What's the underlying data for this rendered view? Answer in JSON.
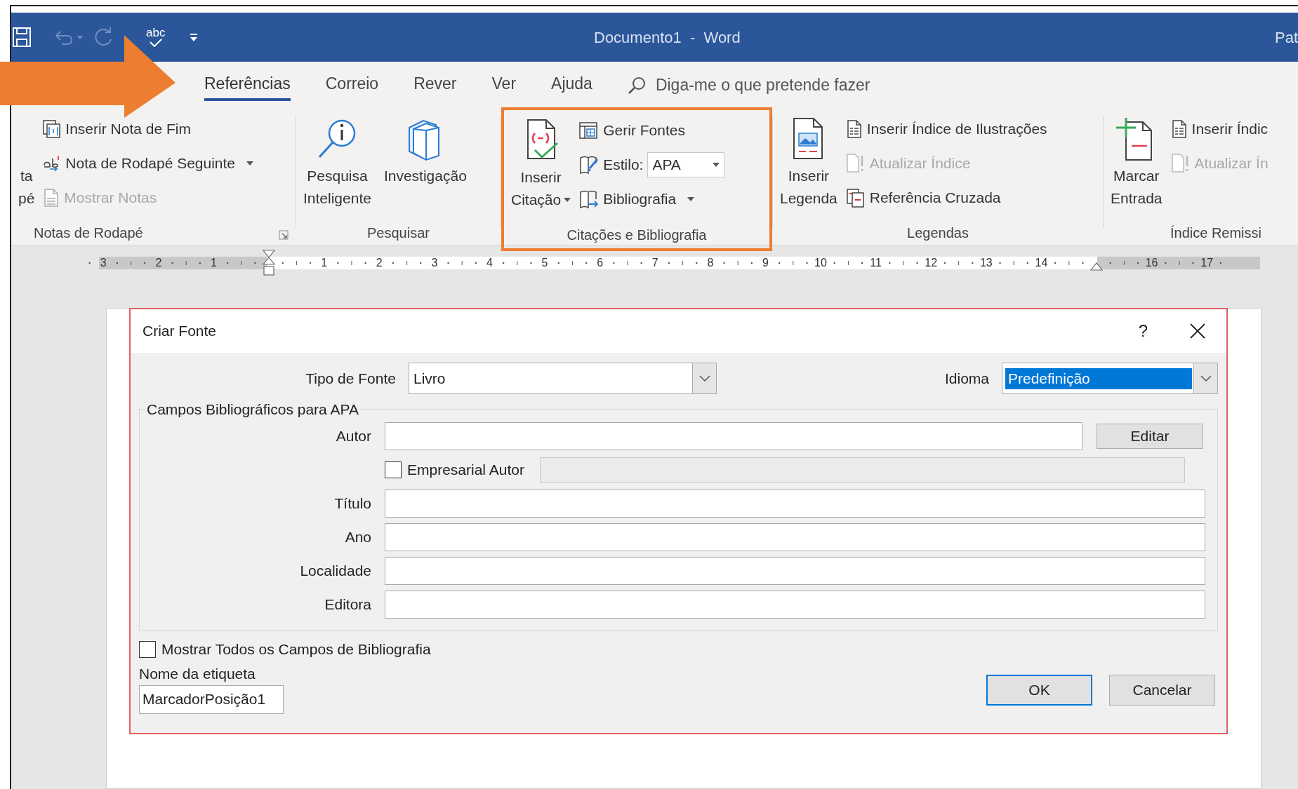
{
  "window": {
    "title": "Documento1  -  Word",
    "account": "Pat"
  },
  "quick_access": {
    "spelling_label": "abc"
  },
  "tabs": [
    {
      "label": "Referências",
      "selected": true
    },
    {
      "label": "Correio",
      "selected": false
    },
    {
      "label": "Rever",
      "selected": false
    },
    {
      "label": "Ver",
      "selected": false
    },
    {
      "label": "Ajuda",
      "selected": false
    }
  ],
  "tell_me": {
    "placeholder": "Diga-me o que pretende fazer"
  },
  "ribbon": {
    "groups": [
      {
        "label": "Notas de Rodapé",
        "highlighted": false,
        "launcher": true,
        "columns": [
          {
            "kind": "large",
            "lines": [
              "ta",
              "pé"
            ],
            "dropdown": false
          },
          {
            "kind": "stack",
            "items": [
              {
                "kind": "button",
                "label": "Inserir Nota de Fim",
                "disabled": false,
                "dropdown": false
              },
              {
                "kind": "button",
                "label": "Nota de Rodapé Seguinte",
                "disabled": false,
                "dropdown": true
              },
              {
                "kind": "button",
                "label": "Mostrar Notas",
                "disabled": true,
                "dropdown": false
              }
            ]
          }
        ]
      },
      {
        "label": "Pesquisar",
        "highlighted": false,
        "columns": [
          {
            "kind": "large",
            "lines": [
              "Pesquisa",
              "Inteligente"
            ],
            "dropdown": false
          },
          {
            "kind": "large",
            "lines": [
              "Investigação"
            ],
            "dropdown": false
          }
        ]
      },
      {
        "label": "Citações e Bibliografia",
        "highlighted": true,
        "launcher": false,
        "columns": [
          {
            "kind": "large",
            "lines": [
              "Inserir",
              "Citação"
            ],
            "dropdown": true
          },
          {
            "kind": "stack",
            "items": [
              {
                "kind": "button",
                "label": "Gerir Fontes",
                "disabled": false,
                "dropdown": false
              },
              {
                "kind": "combo",
                "label": "Estilo:",
                "value": "APA"
              },
              {
                "kind": "button",
                "label": "Bibliografia",
                "disabled": false,
                "dropdown": true
              }
            ]
          }
        ]
      },
      {
        "label": "Legendas",
        "highlighted": false,
        "launcher": false,
        "columns": [
          {
            "kind": "large",
            "lines": [
              "Inserir",
              "Legenda"
            ],
            "dropdown": false
          },
          {
            "kind": "stack",
            "items": [
              {
                "kind": "button",
                "label": "Inserir Índice de Ilustrações",
                "disabled": false,
                "dropdown": false
              },
              {
                "kind": "button",
                "label": "Atualizar Índice",
                "disabled": true,
                "dropdown": false
              },
              {
                "kind": "button",
                "label": "Referência Cruzada",
                "disabled": false,
                "dropdown": false
              }
            ]
          }
        ]
      },
      {
        "label": "Índice Remissi",
        "highlighted": false,
        "launcher": false,
        "columns": [
          {
            "kind": "large",
            "lines": [
              "Marcar",
              "Entrada"
            ],
            "dropdown": false
          },
          {
            "kind": "stack",
            "items": [
              {
                "kind": "button",
                "label": "Inserir Índic",
                "disabled": false,
                "dropdown": false
              },
              {
                "kind": "button",
                "label": "Atualizar Ín",
                "disabled": true,
                "dropdown": false
              }
            ]
          }
        ]
      }
    ]
  },
  "ruler": {
    "marks": [
      {
        "kind": "number",
        "text": "3"
      },
      {
        "kind": "number",
        "text": "2"
      },
      {
        "kind": "number",
        "text": "1"
      },
      {
        "kind": "left_indent"
      },
      {
        "kind": "number",
        "text": "1"
      },
      {
        "kind": "number",
        "text": "2"
      },
      {
        "kind": "number",
        "text": "3"
      },
      {
        "kind": "number",
        "text": "4"
      },
      {
        "kind": "number",
        "text": "5"
      },
      {
        "kind": "number",
        "text": "6"
      },
      {
        "kind": "number",
        "text": "7"
      },
      {
        "kind": "number",
        "text": "8"
      },
      {
        "kind": "number",
        "text": "9"
      },
      {
        "kind": "number",
        "text": "10"
      },
      {
        "kind": "number",
        "text": "11"
      },
      {
        "kind": "number",
        "text": "12"
      },
      {
        "kind": "number",
        "text": "13"
      },
      {
        "kind": "number",
        "text": "14"
      },
      {
        "kind": "right_indent"
      },
      {
        "kind": "number",
        "text": "16"
      },
      {
        "kind": "number",
        "text": "17"
      }
    ]
  },
  "dialog": {
    "title": "Criar Fonte",
    "help": "?",
    "source_type": {
      "label": "Tipo de Fonte",
      "value": "Livro"
    },
    "language": {
      "label": "Idioma",
      "value": "Predefinição",
      "selected": true
    },
    "fields_group": {
      "title": "Campos Bibliográficos para APA",
      "fields": [
        {
          "kind": "text",
          "label": "Autor",
          "button": "Editar"
        },
        {
          "kind": "checkbox",
          "label": "Empresarial Autor",
          "checked": false,
          "field_disabled": true
        },
        {
          "kind": "text",
          "label": "Título"
        },
        {
          "kind": "text",
          "label": "Ano"
        },
        {
          "kind": "text",
          "label": "Localidade"
        },
        {
          "kind": "text",
          "label": "Editora"
        }
      ]
    },
    "show_all": {
      "label": "Mostrar Todos os Campos de Bibliografia",
      "checked": false
    },
    "tag_name": {
      "label": "Nome da etiqueta",
      "value": "MarcadorPosição1"
    },
    "buttons": [
      {
        "label": "OK",
        "default": true
      },
      {
        "label": "Cancelar",
        "default": false
      }
    ]
  }
}
